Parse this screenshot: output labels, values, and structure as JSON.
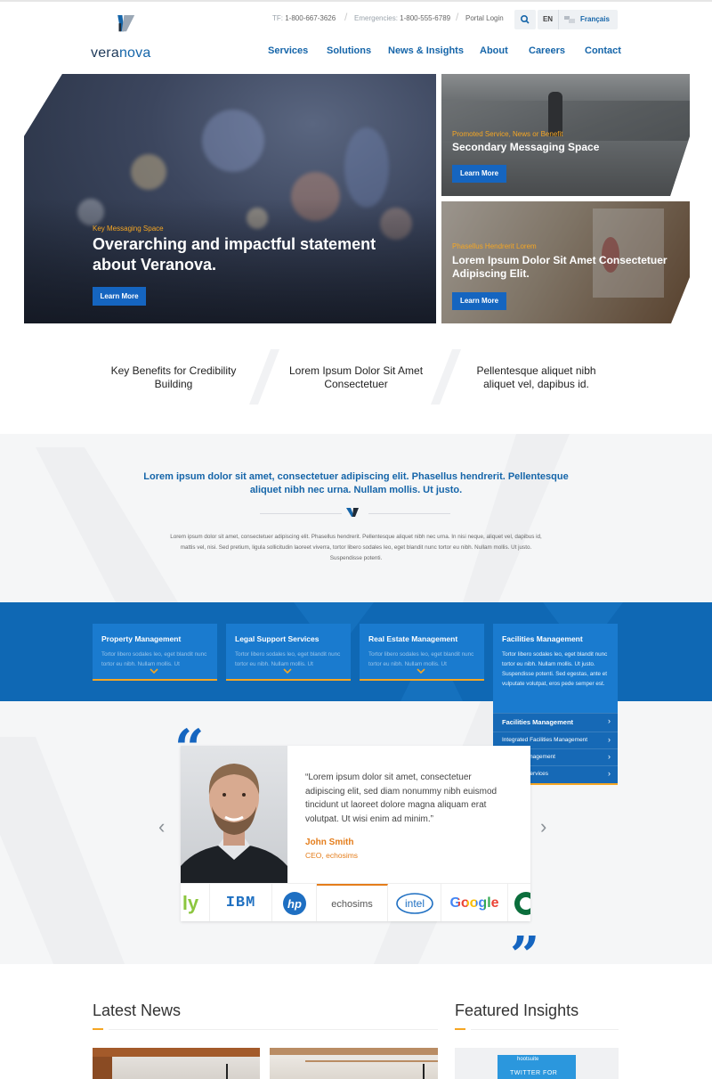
{
  "brand": {
    "name_part1": "vera",
    "name_part2": "nova",
    "accent": "#1565a9",
    "orange": "#f5a623"
  },
  "utility": {
    "tel_label": "TF:",
    "tel": "1-800-667-3626",
    "emergency_label": "Emergencies:",
    "emergency": "1-800-555-6789",
    "portal": "Portal Login",
    "lang_en": "EN",
    "lang_fr": "Français"
  },
  "nav": [
    "Services",
    "Solutions",
    "News & Insights",
    "About",
    "Careers",
    "Contact"
  ],
  "hero": {
    "main": {
      "eyebrow": "Key Messaging Space",
      "title": "Overarching and impactful statement about Veranova.",
      "cta": "Learn More"
    },
    "side1": {
      "eyebrow": "Promoted Service, News or Benefit",
      "title": "Secondary Messaging Space",
      "cta": "Learn More"
    },
    "side2": {
      "eyebrow": "Phasellus Hendrerit Lorem",
      "title": "Lorem Ipsum Dolor Sit Amet Consectetuer Adipiscing Elit.",
      "cta": "Learn More"
    }
  },
  "benefits": [
    "Key Benefits for Credibility Building",
    "Lorem Ipsum Dolor Sit Amet Consectetuer",
    "Pellentesque aliquet nibh aliquet vel, dapibus id."
  ],
  "intro": {
    "headline": "Lorem ipsum dolor sit amet, consectetuer adipiscing elit. Phasellus hendrerit. Pellentesque aliquet nibh nec urna. Nullam mollis. Ut justo.",
    "body": "Lorem ipsum dolor sit amet, consectetuer adipiscing elit. Phasellus hendrerit. Pellentesque aliquet nibh nec urna. In nisi neque, aliquet vel, dapibus id, mattis vel, nisi. Sed pretium, ligula sollicitudin laoreet viverra, tortor libero sodales leo, eget blandit nunc tortor eu nibh. Nullam mollis. Ut justo. Suspendisse potenti."
  },
  "services": [
    {
      "title": "Property Management",
      "desc": "Tortor libero sodales leo, eget blandit nunc tortor eu nibh. Nullam mollis. Ut"
    },
    {
      "title": "Legal Support Services",
      "desc": "Tortor libero sodales leo, eget blandit nunc tortor eu nibh. Nullam mollis. Ut"
    },
    {
      "title": "Real Estate Management",
      "desc": "Tortor libero sodales leo, eget blandit nunc tortor eu nibh. Nullam mollis. Ut"
    },
    {
      "title": "Facilities Management",
      "desc": "Tortor libero sodales leo, eget blandit nunc tortor eu nibh. Nullam mollis. Ut justo. Suspendisse potenti. Sed egestas, ante et vulputate volutpat, eros pede semper est."
    }
  ],
  "submenu": [
    "Facilities Management",
    "Integrated Facilities Management",
    "Project Management",
    "Facilities Services"
  ],
  "testimonial": {
    "quote": "“Lorem ipsum dolor sit amet, consectetuer adipiscing elit, sed diam nonummy nibh euismod tincidunt ut laoreet dolore magna aliquam erat volutpat. Ut wisi enim ad minim.”",
    "name": "John Smith",
    "role": "CEO, echosims"
  },
  "client_logos": [
    "ly",
    "IBM",
    "hp",
    "echosims",
    "intel",
    "Google",
    "starbucks-logo"
  ],
  "sections": {
    "news": "Latest News",
    "insights": "Featured Insights"
  },
  "insight_thumb": {
    "label": "TWITTER FOR",
    "brand": "hootsuite"
  }
}
